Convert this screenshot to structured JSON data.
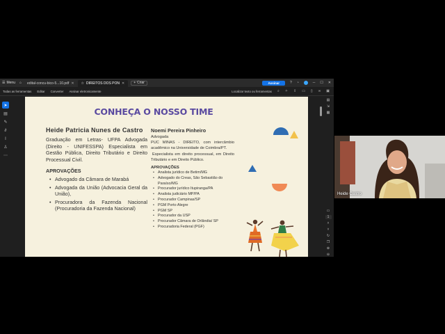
{
  "window": {
    "menu_label": "Menu",
    "tabs": [
      {
        "label": "edital-concu-bico-5...10.pdf"
      },
      {
        "label": "DIREITOS DOS PON"
      }
    ],
    "new_tab_label": "Criar",
    "sign_button": "Assinar"
  },
  "toolbar": {
    "items": [
      "Todas as ferramentas",
      "Editar",
      "Converter",
      "Assinar eletronicamente"
    ],
    "find_label": "Localizar texto ou ferramentas"
  },
  "page_indicator": "1",
  "slide": {
    "title": "CONHEÇA O NOSSO TIME",
    "person1": {
      "name": "Heide Patricia Nunes de Castro",
      "bio": "Graduação em Letras- UFPA Advogada (Direito - UNIFESSPA) Especialista em Gestão Pública, Direito Tributário e Direito Processual Civil.",
      "approvals_heading": "APROVAÇÕES",
      "approvals": [
        "Advogado da Câmara de Marabá",
        "Advogada da União (Advocacia Geral da União),",
        "Procuradora da Fazenda Nacional (Procuradoria da Fazenda Nacional)"
      ]
    },
    "person2": {
      "name": "Noemi Pereira Pinheiro",
      "role": "Advogada",
      "bio1": "PUC MINAS - DIREITO, com intercâmbio acadêmico na Universidade de Coimbra/PT.",
      "bio2": "Especialista em direito processual, em Direito Tributário e em Direito Público.",
      "approvals_heading": "APROVAÇÕES",
      "approvals": [
        "Analista jurídico de Betim/MG",
        "Advogado do Creas, São Sebastião do Paraíso/MG",
        "Procurador jurídico Itupiranga/PA",
        "Analista judiciário MP/PA",
        "Procurador Campinas/SP",
        "PGM Porto Alegre",
        "PGM SP",
        "Procurador da USP",
        "Procurador Câmara de Orlândia/ SP",
        "Procuradoria Federal (PGF)"
      ]
    },
    "colors": {
      "background": "#f6f1de",
      "title": "#5a4aa0",
      "blue": "#2f6db3",
      "orange": "#f08a55",
      "yellow": "#f2c14b"
    }
  },
  "webcam": {
    "participant_name": "Heide Castro"
  }
}
